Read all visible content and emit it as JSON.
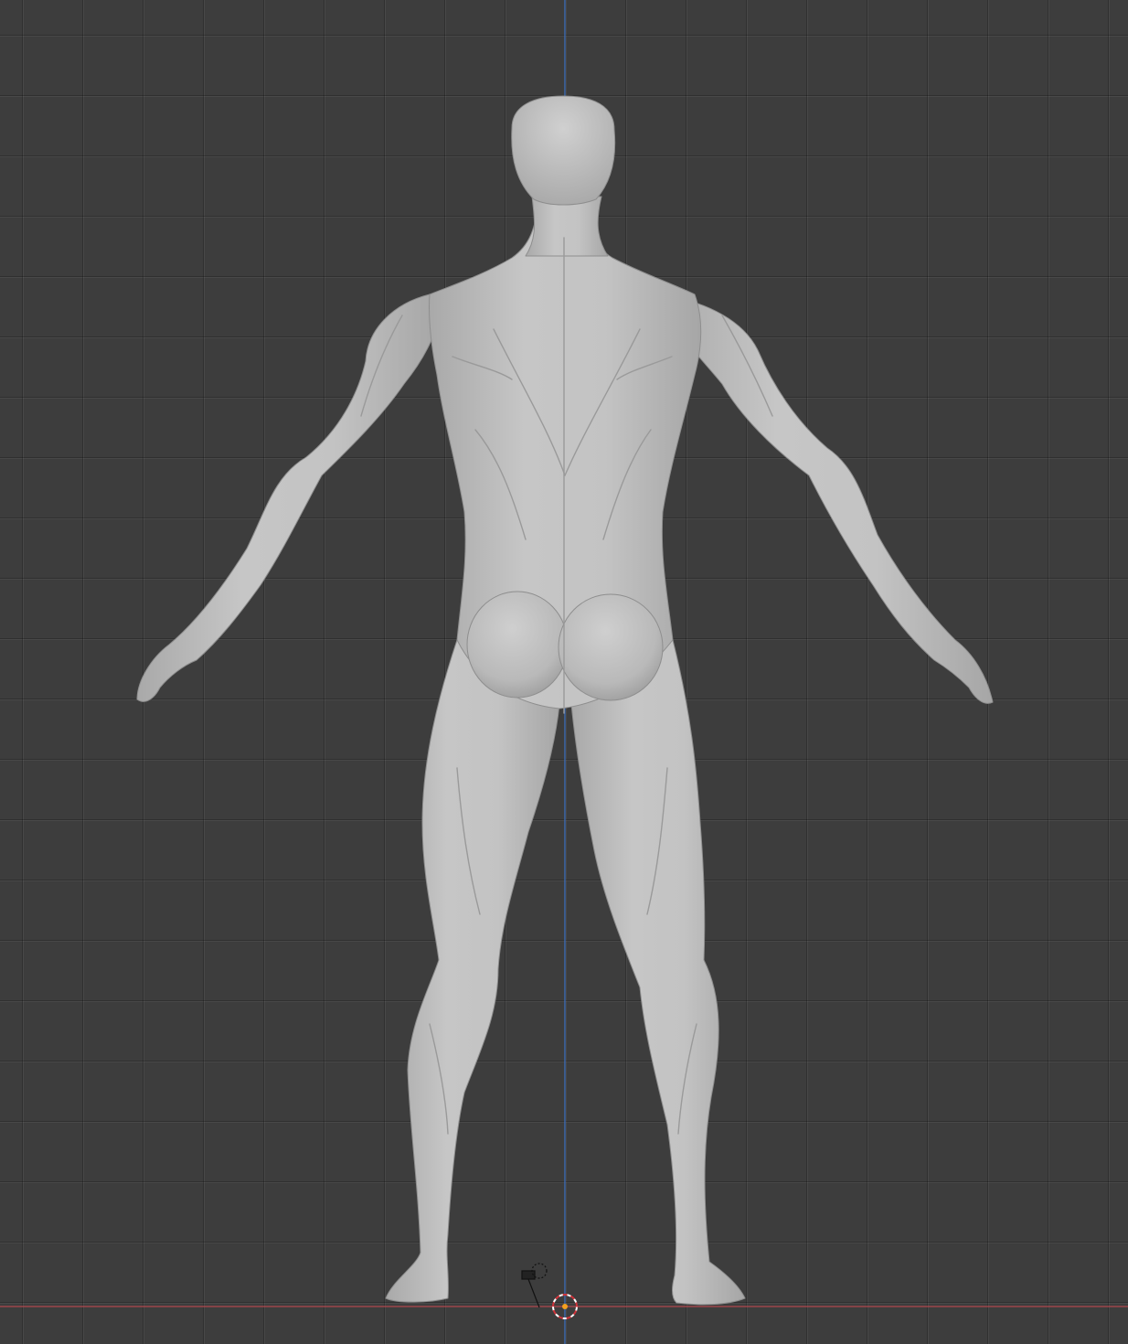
{
  "viewport": {
    "view": "back-orthographic",
    "mode": "sculpt",
    "grid": true,
    "background_color": "#3d3d3d",
    "grid_color": "#2f2f2f",
    "axis_colors": {
      "x_axis": "#b0474e",
      "z_axis": "#3f74c6"
    },
    "mesh_color": "#bdbdbd"
  },
  "scene_objects": {
    "mesh": {
      "type": "sculpted-human-body",
      "pose": "a-pose",
      "facing": "away"
    },
    "camera_icon": "camera-icon",
    "cursor_icon": "3d-cursor-icon",
    "origin_icon": "origin-point-icon"
  }
}
